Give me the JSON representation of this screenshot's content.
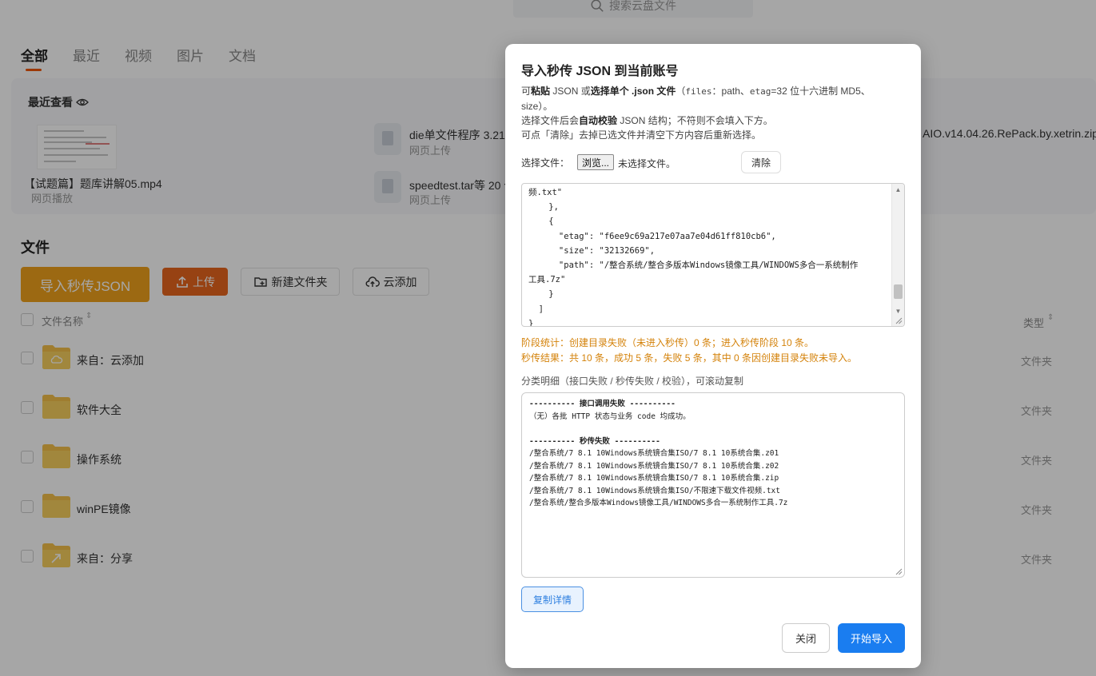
{
  "search": {
    "placeholder": "搜索云盘文件"
  },
  "tabs": [
    {
      "label": "全部",
      "active": true
    },
    {
      "label": "最近"
    },
    {
      "label": "视频"
    },
    {
      "label": "图片"
    },
    {
      "label": "文档"
    }
  ],
  "recent": {
    "title": "最近查看",
    "items": [
      {
        "name": "【试题篇】题库讲解05.mp4",
        "sub": "网页播放"
      },
      {
        "name": "die单文件程序 3.21",
        "sub": "网页上传"
      },
      {
        "name": "speedtest.tar等 20 个",
        "sub": "网页上传"
      },
      {
        "name": "AIO.v14.04.26.RePack.by.xetrin.zip"
      }
    ]
  },
  "files": {
    "heading": "文件",
    "import_json_label": "导入秒传JSON",
    "upload_label": "上传",
    "new_folder_label": "新建文件夹",
    "cloud_add_label": "云添加",
    "col_name": "文件名称",
    "col_type": "类型",
    "rows": [
      {
        "name": "来自：云添加",
        "type": "文件夹"
      },
      {
        "name": "软件大全",
        "type": "文件夹"
      },
      {
        "name": "操作系统",
        "type": "文件夹"
      },
      {
        "name": "winPE镜像",
        "type": "文件夹"
      },
      {
        "name": "来自：分享",
        "type": "文件夹"
      }
    ]
  },
  "dialog": {
    "title": "导入秒传 JSON 到当前账号",
    "desc": {
      "p1a": "可",
      "p1b": "粘贴",
      "p1c": " JSON 或",
      "p1d": "选择单个 .json 文件",
      "p1e": "（",
      "p1f": "files",
      "p1g": "：path、",
      "p1h": "etag",
      "p1i": "=32 位十六进制 MD5、size）。",
      "p2a": "选择文件后会",
      "p2b": "自动校验",
      "p2c": " JSON 结构；不符则不会填入下方。",
      "p3": "可点「清除」去掉已选文件并清空下方内容后重新选择。"
    },
    "file_label": "选择文件：",
    "browse_label": "浏览...",
    "no_file_label": "未选择文件。",
    "clear_label": "清除",
    "json_text": "频.txt\"\n    },\n    {\n      \"etag\": \"f6ee9c69a217e07aa7e04d61ff810cb6\",\n      \"size\": \"32132669\",\n      \"path\": \"/整合系统/整合多版本Windows镜像工具/WINDOWS多合一系统制作\n工具.7z\"\n    }\n  ]\n}",
    "stats_line1": "阶段统计：创建目录失败（未进入秒传）0 条；进入秒传阶段 10 条。",
    "stats_line2": "秒传结果：共 10 条，成功 5 条，失败 5 条，其中 0 条因创建目录失败未导入。",
    "detail_label": "分类明细（接口失败 / 秒传失败 / 校验），可滚动复制",
    "detail_h1": "---------- 接口调用失败 ----------",
    "detail_l1": "（无）各批 HTTP 状态与业务 code 均成功。",
    "detail_h2": "---------- 秒传失败 ----------",
    "detail_lines": "/整合系统/7 8.1 10Windows系统镜合集ISO/7 8.1 10系统合集.z01\n/整合系统/7 8.1 10Windows系统镜合集ISO/7 8.1 10系统合集.z02\n/整合系统/7 8.1 10Windows系统镜合集ISO/7 8.1 10系统合集.zip\n/整合系统/7 8.1 10Windows系统镜合集ISO/不限速下载文件视频.txt\n/整合系统/整合多版本Windows镜像工具/WINDOWS多合一系统制作工具.7z",
    "copy_label": "复制详情",
    "close_label": "关闭",
    "start_label": "开始导入"
  }
}
